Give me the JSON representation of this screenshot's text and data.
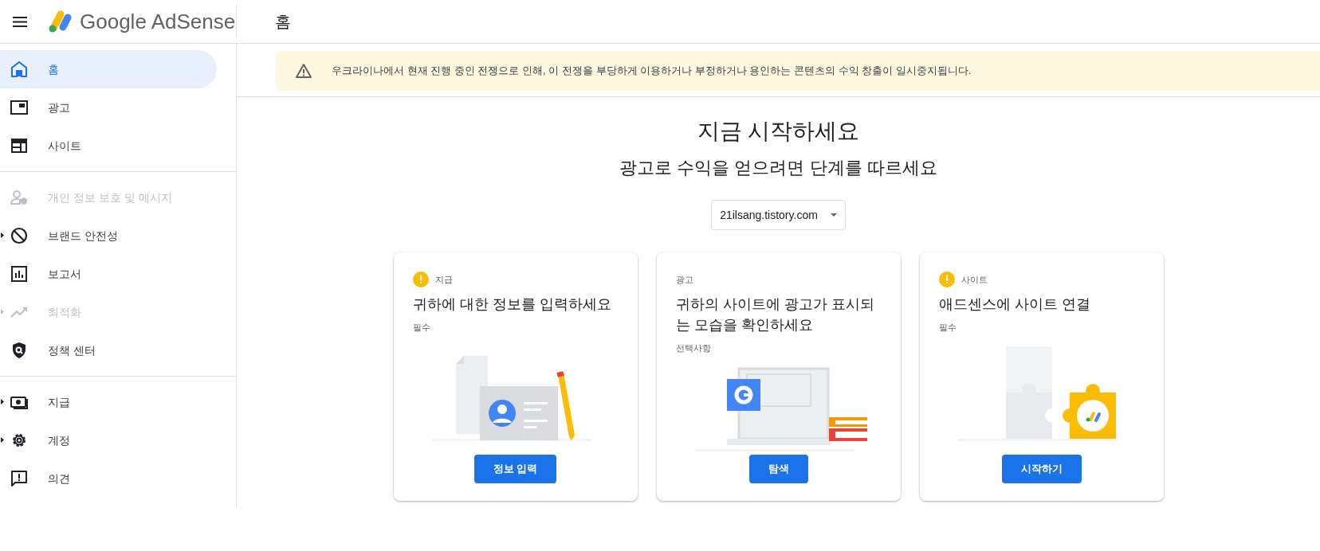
{
  "header": {
    "product": "Google AdSense",
    "page_title": "홈"
  },
  "sidebar": {
    "groups": [
      {
        "items": [
          {
            "label": "홈",
            "selected": true,
            "disabled": false,
            "expandable": false
          },
          {
            "label": "광고",
            "selected": false,
            "disabled": false,
            "expandable": false
          },
          {
            "label": "사이트",
            "selected": false,
            "disabled": false,
            "expandable": false
          }
        ]
      },
      {
        "items": [
          {
            "label": "개인 정보 보호 및 메시지",
            "selected": false,
            "disabled": true,
            "expandable": false
          },
          {
            "label": "브랜드 안전성",
            "selected": false,
            "disabled": false,
            "expandable": true
          },
          {
            "label": "보고서",
            "selected": false,
            "disabled": false,
            "expandable": false
          },
          {
            "label": "최적화",
            "selected": false,
            "disabled": true,
            "expandable": true
          },
          {
            "label": "정책 센터",
            "selected": false,
            "disabled": false,
            "expandable": false
          }
        ]
      },
      {
        "items": [
          {
            "label": "지급",
            "selected": false,
            "disabled": false,
            "expandable": true
          },
          {
            "label": "계정",
            "selected": false,
            "disabled": false,
            "expandable": true
          },
          {
            "label": "의견",
            "selected": false,
            "disabled": false,
            "expandable": false
          }
        ]
      }
    ]
  },
  "banner": {
    "text": "우크라이나에서 현재 진행 중인 전쟁으로 인해, 이 전쟁을 부당하게 이용하거나 부정하거나 용인하는 콘텐츠의 수익 창출이 일시중지됩니다."
  },
  "main": {
    "title": "지금 시작하세요",
    "subtitle": "광고로 수익을 얻으려면 단계를 따르세요",
    "site_select": "21ilsang.tistory.com"
  },
  "cards": [
    {
      "warning": true,
      "tag": "지급",
      "title": "귀하에 대한 정보를 입력하세요",
      "note": "필수",
      "button": "정보 입력"
    },
    {
      "warning": false,
      "tag": "광고",
      "title": "귀하의 사이트에 광고가 표시되는 모습을 확인하세요",
      "note": "선택사항",
      "button": "탐색"
    },
    {
      "warning": true,
      "tag": "사이트",
      "title": "애드센스에 사이트 연결",
      "note": "필수",
      "button": "시작하기"
    }
  ]
}
